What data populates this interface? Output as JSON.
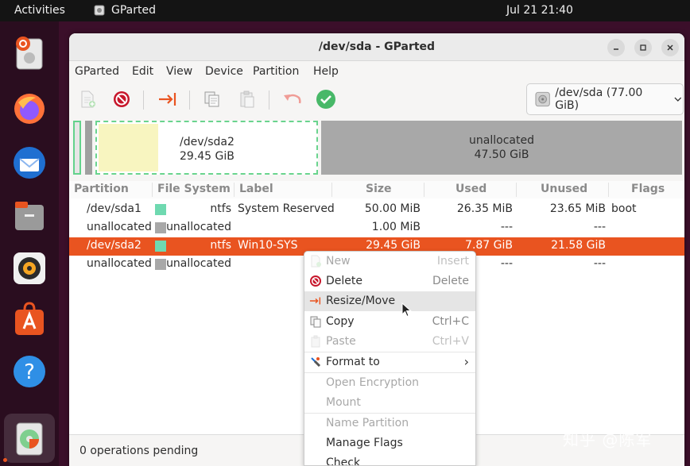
{
  "topbar": {
    "activities": "Activities",
    "app_name": "GParted",
    "clock": "Jul 21  21:40"
  },
  "dock": {
    "apps": [
      "installer",
      "firefox",
      "thunderbird",
      "files",
      "rhythmbox",
      "app-center",
      "help",
      "gparted"
    ],
    "active": "gparted"
  },
  "window": {
    "title": "/dev/sda - GParted"
  },
  "menubar": {
    "items": [
      "GParted",
      "Edit",
      "View",
      "Device",
      "Partition",
      "Help"
    ]
  },
  "toolbar": {
    "buttons": [
      "new",
      "delete",
      "resize-move",
      "copy",
      "paste",
      "undo",
      "apply"
    ],
    "device": "/dev/sda (77.00 GiB)"
  },
  "diskmap": {
    "sda2": {
      "name": "/dev/sda2",
      "size": "29.45 GiB",
      "used_fraction": 0.27
    },
    "unallocated": {
      "name": "unallocated",
      "size": "47.50 GiB"
    }
  },
  "table": {
    "headers": [
      "Partition",
      "File System",
      "Label",
      "Size",
      "Used",
      "Unused",
      "Flags"
    ],
    "rows": [
      {
        "partition": "/dev/sda1",
        "fs": "ntfs",
        "fs_color": "#6fd9b0",
        "label": "System Reserved",
        "size": "50.00 MiB",
        "used": "26.35 MiB",
        "unused": "23.65 MiB",
        "flags": "boot",
        "selected": false
      },
      {
        "partition": "unallocated",
        "fs": "unallocated",
        "fs_color": "#a8a8a8",
        "label": "",
        "size": "1.00 MiB",
        "used": "---",
        "unused": "---",
        "flags": "",
        "selected": false
      },
      {
        "partition": "/dev/sda2",
        "fs": "ntfs",
        "fs_color": "#6fd9b0",
        "label": "Win10-SYS",
        "size": "29.45 GiB",
        "used": "7.87 GiB",
        "unused": "21.58 GiB",
        "flags": "",
        "selected": true
      },
      {
        "partition": "unallocated",
        "fs": "unallocated",
        "fs_color": "#a8a8a8",
        "label": "",
        "size": "",
        "used": "---",
        "unused": "---",
        "flags": "",
        "selected": false
      }
    ]
  },
  "status": {
    "text": "0 operations pending"
  },
  "context_menu": {
    "items": [
      {
        "label": "New",
        "accel": "Insert",
        "disabled": true
      },
      {
        "label": "Delete",
        "accel": "Delete",
        "disabled": false
      },
      {
        "label": "Resize/Move",
        "accel": "",
        "disabled": false,
        "hover": true
      },
      {
        "label": "Copy",
        "accel": "Ctrl+C",
        "disabled": false
      },
      {
        "label": "Paste",
        "accel": "Ctrl+V",
        "disabled": true
      },
      {
        "label": "Format to",
        "accel": "›",
        "disabled": false
      },
      {
        "label": "Open Encryption",
        "accel": "",
        "disabled": true
      },
      {
        "label": "Mount",
        "accel": "",
        "disabled": true
      },
      {
        "label": "Name Partition",
        "accel": "",
        "disabled": true
      },
      {
        "label": "Manage Flags",
        "accel": "",
        "disabled": false
      },
      {
        "label": "Check",
        "accel": "",
        "disabled": false
      }
    ]
  },
  "watermark": "知乎 @陈军",
  "colors": {
    "accent": "#e95420",
    "ntfs": "#6fd9b0",
    "unallocated": "#a8a8a8",
    "used": "#f8f5c0"
  }
}
